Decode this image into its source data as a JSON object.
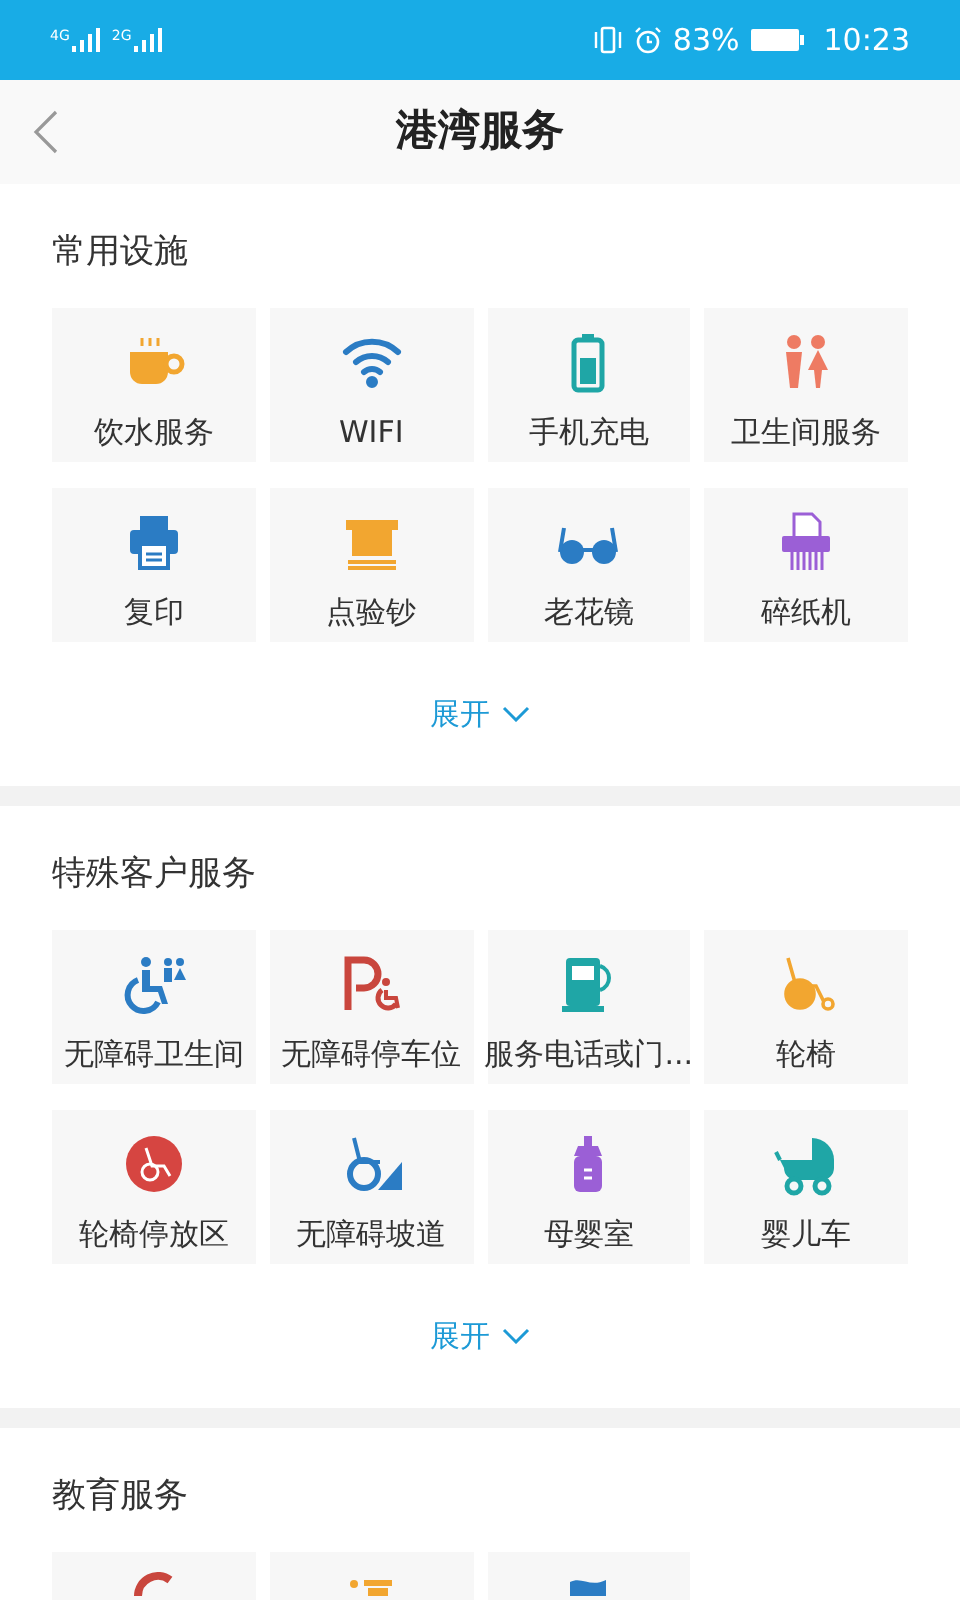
{
  "status_bar": {
    "network_1": "4G",
    "network_2": "2G",
    "battery": "83%",
    "time": "10:23"
  },
  "header": {
    "title": "港湾服务"
  },
  "sections": [
    {
      "title": "常用设施",
      "items": [
        {
          "label": "饮水服务"
        },
        {
          "label": "WIFI"
        },
        {
          "label": "手机充电"
        },
        {
          "label": "卫生间服务"
        },
        {
          "label": "复印"
        },
        {
          "label": "点验钞"
        },
        {
          "label": "老花镜"
        },
        {
          "label": "碎纸机"
        }
      ],
      "expand": "展开"
    },
    {
      "title": "特殊客户服务",
      "items": [
        {
          "label": "无障碍卫生间"
        },
        {
          "label": "无障碍停车位"
        },
        {
          "label": "服务电话或门..."
        },
        {
          "label": "轮椅"
        },
        {
          "label": "轮椅停放区"
        },
        {
          "label": "无障碍坡道"
        },
        {
          "label": "母婴室"
        },
        {
          "label": "婴儿车"
        }
      ],
      "expand": "展开"
    },
    {
      "title": "教育服务",
      "items": [
        {
          "kind": "partial"
        },
        {
          "kind": "partial"
        },
        {
          "kind": "partial"
        }
      ]
    }
  ]
}
